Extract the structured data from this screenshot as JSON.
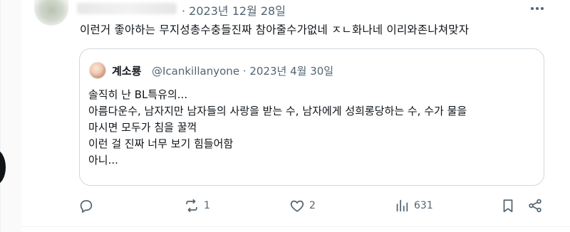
{
  "tweet": {
    "date": "· 2023년 12월 28일",
    "text": "이런거 좋아하는 무지성총수충들진짜 참아줄수가없네 ㅈㄴ화나네 이리와존나쳐맞자"
  },
  "quote": {
    "author_name": "계소룡",
    "handle_and_date": "@Icankillanyone · 2023년 4월 30일",
    "lines": [
      "솔직히 난 BL특유의...",
      "아름다운수, 남자지만 남자들의 사랑을 받는 수, 남자에게 성희롱당하는 수, 수가 물을",
      "마시면 모두가 침을 꿀꺽",
      "이런 걸 진짜 너무 보기 힘들어함",
      "아니..."
    ]
  },
  "actions": {
    "reply_count": "",
    "retweet_count": "1",
    "like_count": "2",
    "views_count": "631"
  },
  "icons": {
    "more": "more-horizontal-icon",
    "reply": "reply-icon",
    "retweet": "retweet-icon",
    "like": "heart-icon",
    "views": "views-chart-icon",
    "bookmark": "bookmark-icon",
    "share": "share-icon"
  },
  "colors": {
    "text_primary": "#0f1419",
    "text_secondary": "#536471",
    "border": "#cfd9de"
  }
}
